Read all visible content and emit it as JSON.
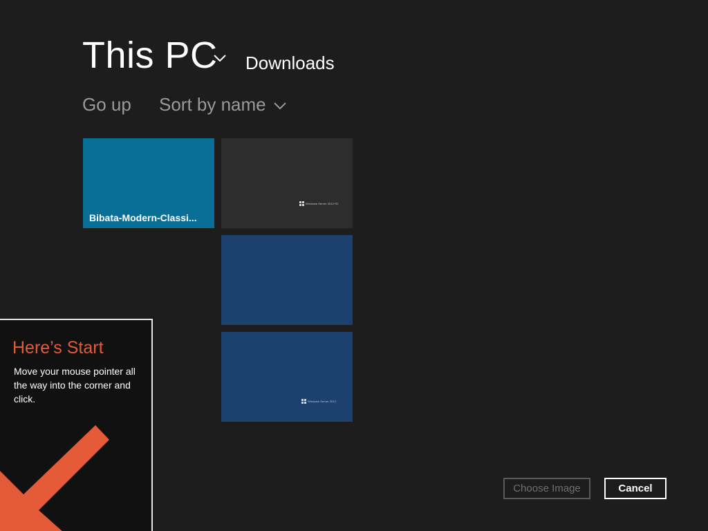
{
  "header": {
    "location": "This PC",
    "current_folder": "Downloads"
  },
  "commands": {
    "go_up": "Go up",
    "sort": "Sort by name"
  },
  "tiles": [
    {
      "type": "folder",
      "label": "Bibata-Modern-Classi...",
      "color": "#0a6f97"
    },
    {
      "type": "image",
      "label": "",
      "color": "#2d2d2d",
      "thumb_text": "Windows Server 2012 R2"
    },
    {
      "type": "image",
      "label": "",
      "color": "#1c416e"
    },
    {
      "type": "image",
      "label": "",
      "color": "#1c416e",
      "thumb_text": "Windows Server 2012"
    }
  ],
  "tip": {
    "title": "Here’s Start",
    "body": "Move your mouse pointer all the way into the corner and click.",
    "title_color": "#e35b38",
    "arrow_color": "#e35b38"
  },
  "buttons": {
    "choose_image": "Choose Image",
    "cancel": "Cancel"
  },
  "icons": {
    "location_dropdown": "chevron-down-icon",
    "sort_dropdown": "chevron-down-icon",
    "start_arrow": "arrow-down-left-icon",
    "windows_logo": "windows-logo-icon"
  }
}
